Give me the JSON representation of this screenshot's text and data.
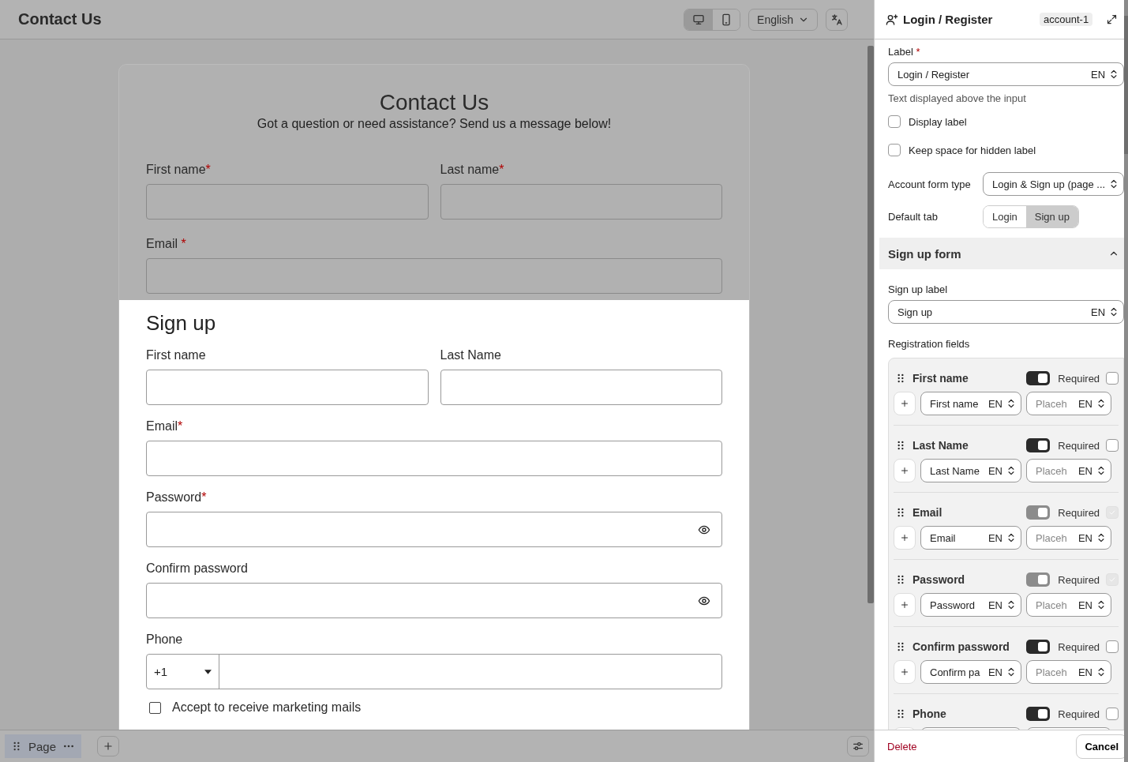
{
  "header": {
    "title": "Contact Us",
    "views": [
      {
        "kind": "desktop",
        "selected": true
      },
      {
        "kind": "mobile",
        "selected": false
      }
    ],
    "language": "English"
  },
  "preview": {
    "title": "Contact Us",
    "subtitle": "Got a question or need assistance? Send us a message below!",
    "rows": [
      [
        {
          "label": "First name",
          "mark": "*"
        },
        {
          "label": "Last name",
          "mark": "*"
        }
      ],
      [
        {
          "label": "Email",
          "mark": " *"
        }
      ]
    ],
    "signup": {
      "title": "Sign up",
      "rows": [
        [
          {
            "label": "First name",
            "kind": "text"
          },
          {
            "label": "Last Name",
            "kind": "text"
          }
        ],
        [
          {
            "label": "Email",
            "mark": "*",
            "kind": "text"
          }
        ],
        [
          {
            "label": "Password",
            "mark": "*",
            "kind": "password"
          }
        ],
        [
          {
            "label": "Confirm password",
            "kind": "password"
          }
        ],
        [
          {
            "label": "Phone",
            "kind": "phone",
            "code": "+1"
          }
        ]
      ],
      "consent": {
        "label": "Accept to receive marketing mails",
        "checked": false
      }
    }
  },
  "bottom_bar": {
    "page": "Page"
  },
  "panel": {
    "title": "Login / Register",
    "tag": "account-1",
    "label_field": {
      "label": "Label",
      "mark": "*",
      "value": "Login / Register",
      "lang": "EN",
      "help": "Text displayed above the input"
    },
    "options": [
      {
        "label": "Display label",
        "checked": false
      },
      {
        "label": "Keep space for hidden label",
        "checked": false
      }
    ],
    "form_type": {
      "label": "Account form type",
      "value": "Login & Sign up (page ..."
    },
    "default_tab": {
      "label": "Default tab",
      "options": [
        {
          "label": "Login",
          "selected": false
        },
        {
          "label": "Sign up",
          "selected": true
        }
      ]
    },
    "section": {
      "title": "Sign up form",
      "expanded": true
    },
    "signup_label": {
      "label": "Sign up label",
      "value": "Sign up",
      "lang": "EN"
    },
    "registration": {
      "title": "Registration fields",
      "items": [
        {
          "name": "First name",
          "enabled": true,
          "disabled": false,
          "required_label": "Required",
          "required": false,
          "value": "First name",
          "lang": "EN",
          "placeholder": "Placeh",
          "placeholder_lang": "EN"
        },
        {
          "name": "Last Name",
          "enabled": true,
          "disabled": false,
          "required_label": "Required",
          "required": false,
          "value": "Last Name",
          "lang": "EN",
          "placeholder": "Placeh",
          "placeholder_lang": "EN"
        },
        {
          "name": "Email",
          "enabled": true,
          "disabled": true,
          "required_label": "Required",
          "required": true,
          "value": "Email",
          "lang": "EN",
          "placeholder": "Placeh",
          "placeholder_lang": "EN"
        },
        {
          "name": "Password",
          "enabled": true,
          "disabled": true,
          "required_label": "Required",
          "required": true,
          "value": "Password",
          "lang": "EN",
          "placeholder": "Placeh",
          "placeholder_lang": "EN"
        },
        {
          "name": "Confirm password",
          "enabled": true,
          "disabled": false,
          "required_label": "Required",
          "required": false,
          "value": "Confirm pa",
          "lang": "EN",
          "placeholder": "Placeh",
          "placeholder_lang": "EN"
        },
        {
          "name": "Phone",
          "enabled": true,
          "disabled": false,
          "required_label": "Required",
          "required": false
        }
      ]
    },
    "delete": "Delete",
    "cancel": "Cancel"
  }
}
